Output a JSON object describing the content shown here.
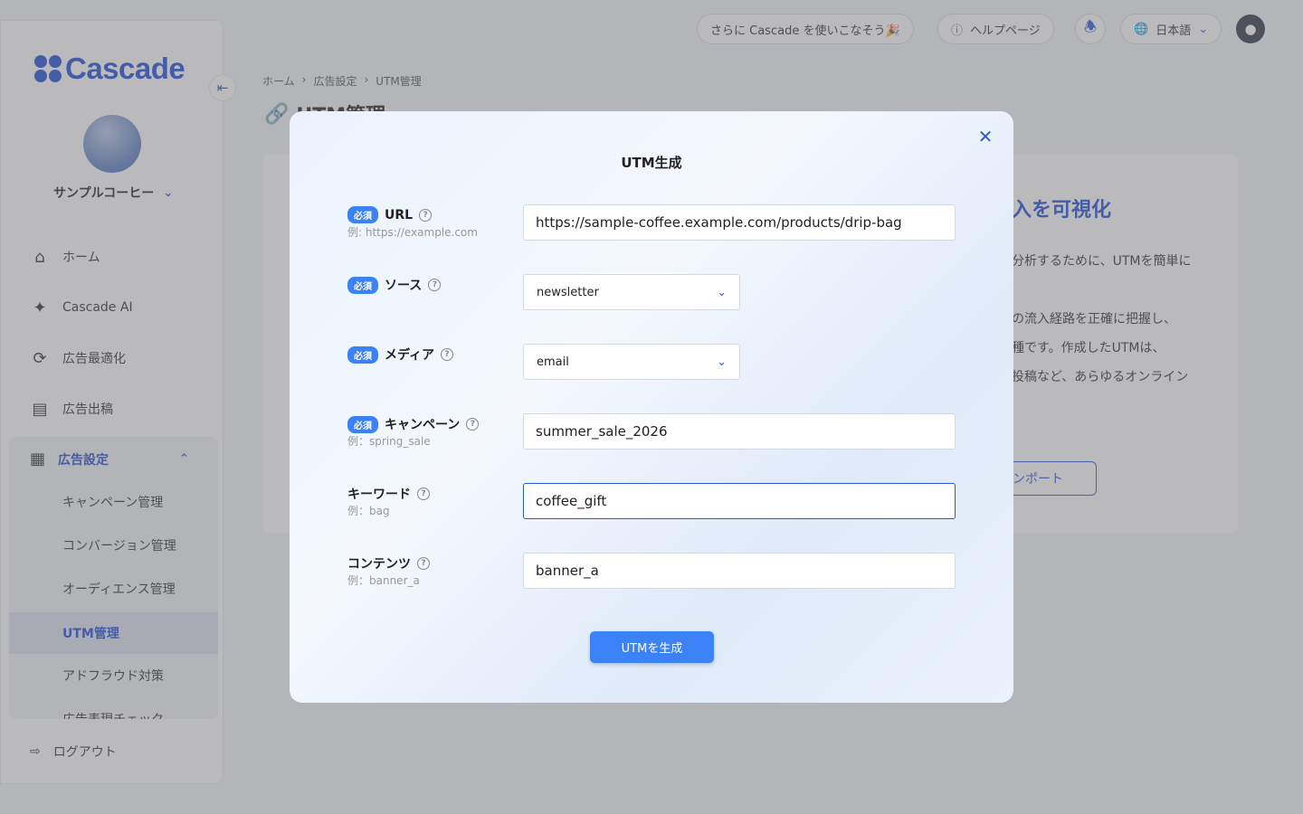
{
  "app": {
    "brand": "Cascade"
  },
  "topbar": {
    "promo": "さらに Cascade を使いこなそう🎉",
    "help": "ヘルプページ",
    "language": "日本語"
  },
  "sidebar": {
    "org_name": "サンプルコーヒー",
    "items": [
      {
        "label": "ホーム",
        "icon": "home-icon"
      },
      {
        "label": "Cascade AI",
        "icon": "sparkle-icon"
      },
      {
        "label": "広告最適化",
        "icon": "optimize-icon"
      },
      {
        "label": "広告出稿",
        "icon": "publish-icon"
      }
    ],
    "group": {
      "label": "広告設定",
      "items": [
        "キャンペーン管理",
        "コンバージョン管理",
        "オーディエンス管理",
        "UTM管理",
        "アドフラウド対策",
        "広告表現チェック"
      ]
    },
    "logout": "ログアウト"
  },
  "breadcrumb": [
    "ホーム",
    "広告設定",
    "UTM管理"
  ],
  "page_title": "UTM管理",
  "background": {
    "headline": "入を可視化",
    "lines": [
      "分析するために、UTMを簡単に",
      "の流入経路を正確に把握し、",
      "種です。作成したUTMは、",
      "投稿など、あらゆるオンライン"
    ],
    "import_label": "ンポート"
  },
  "modal": {
    "title": "UTM生成",
    "required_badge": "必須",
    "fields": {
      "url": {
        "label": "URL",
        "example": "例: https://example.com",
        "value": "https://sample-coffee.example.com/products/drip-bag"
      },
      "source": {
        "label": "ソース",
        "value": "newsletter"
      },
      "medium": {
        "label": "メディア",
        "value": "email"
      },
      "campaign": {
        "label": "キャンペーン",
        "example": "例：spring_sale",
        "value": "summer_sale_2026"
      },
      "keyword": {
        "label": "キーワード",
        "example": "例：bag",
        "value": "coffee_gift"
      },
      "content": {
        "label": "コンテンツ",
        "example": "例：banner_a",
        "value": "banner_a"
      }
    },
    "submit": "UTMを生成"
  },
  "colors": {
    "accent": "#1f4bd6",
    "button": "#3b82f6"
  }
}
